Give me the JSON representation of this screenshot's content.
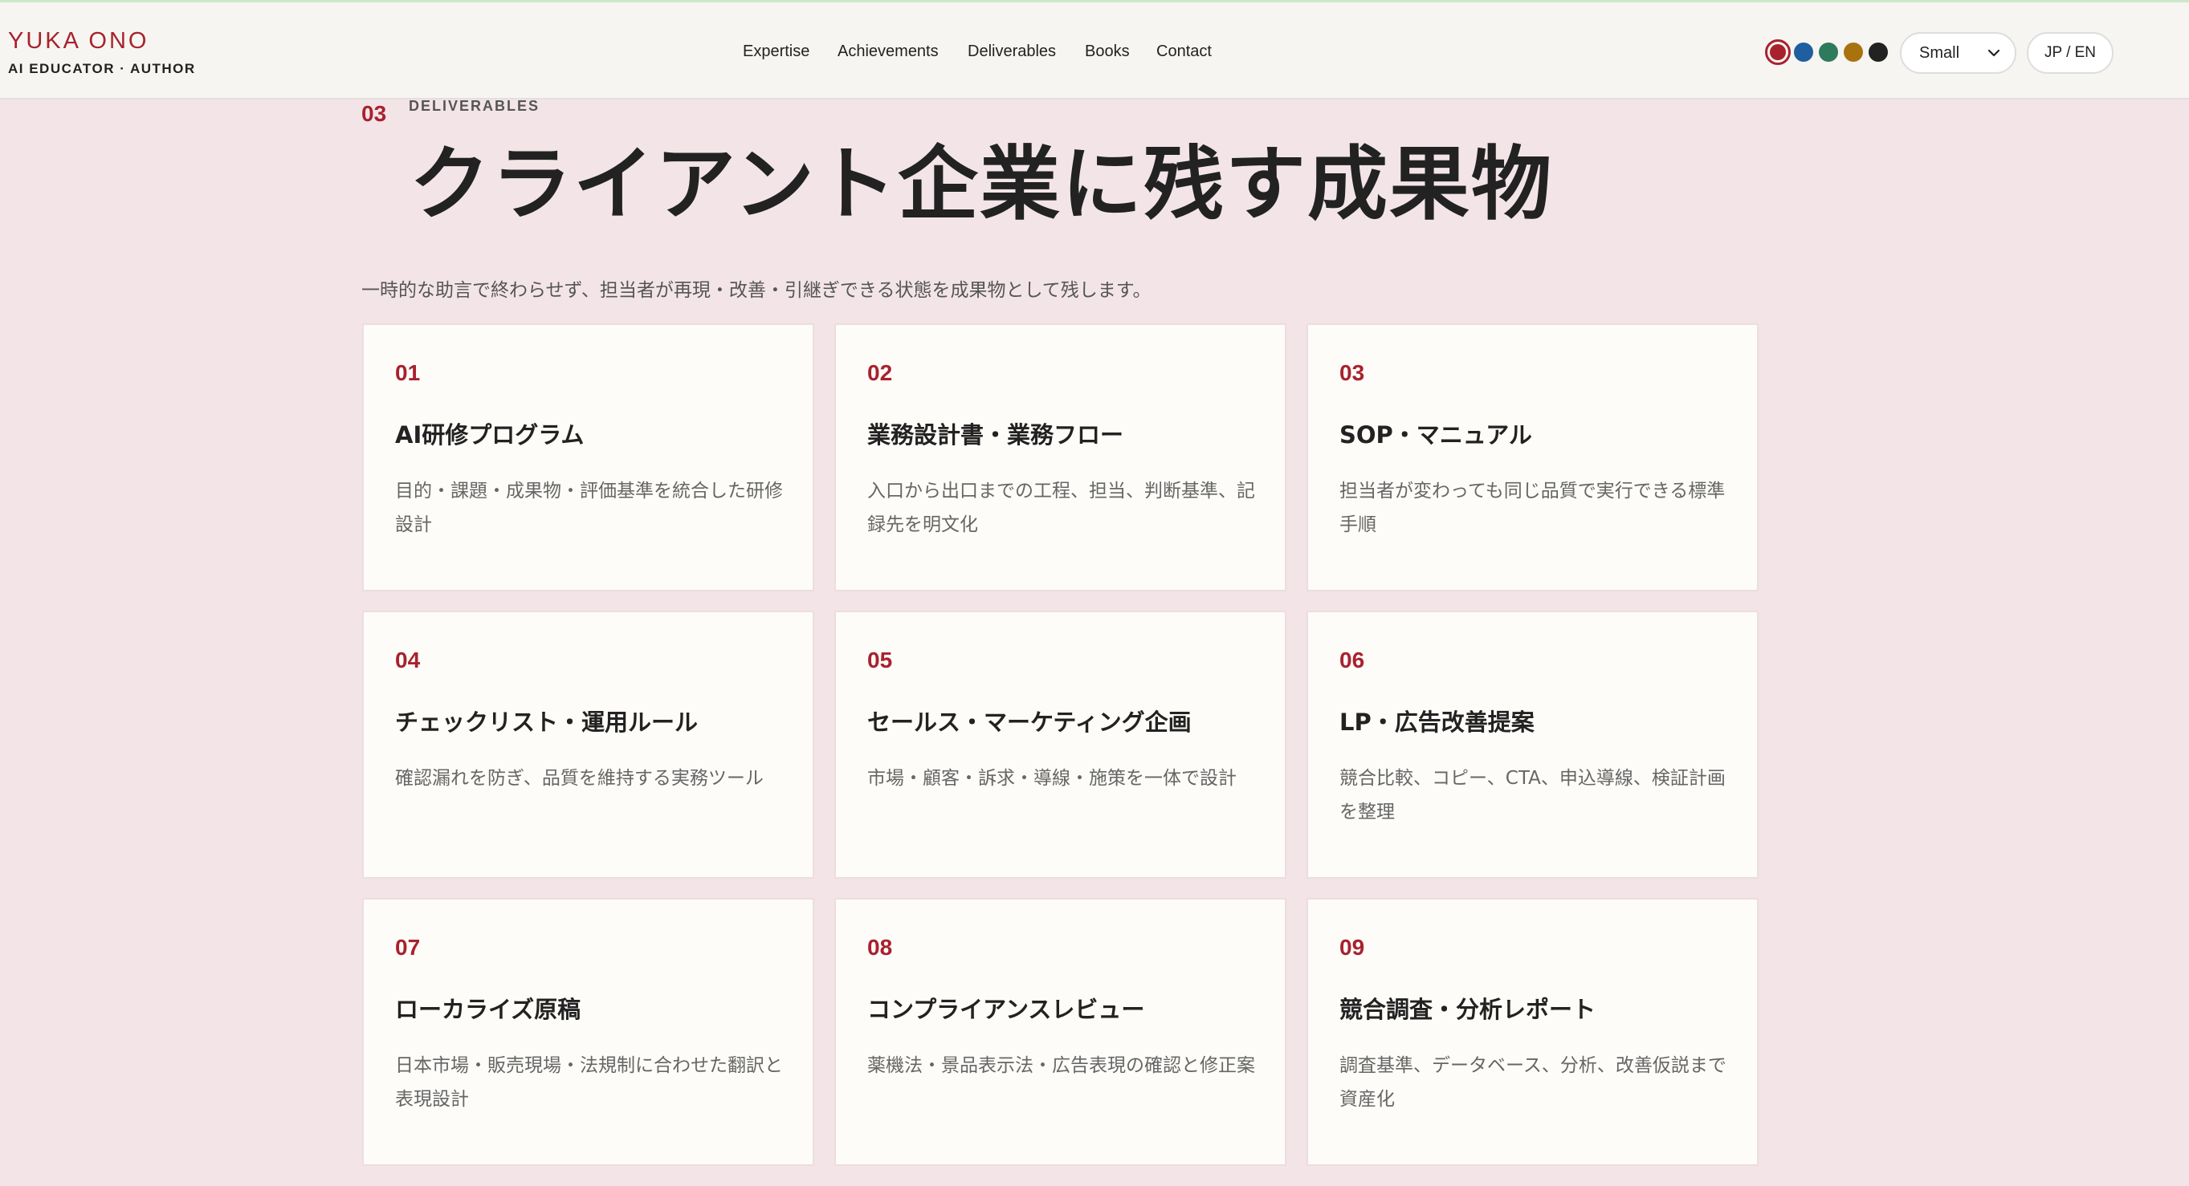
{
  "brand": {
    "name": "YUKA ONO",
    "tagline": "AI EDUCATOR · AUTHOR"
  },
  "nav": {
    "items": [
      "Expertise",
      "Achievements",
      "Deliverables",
      "Books",
      "Contact"
    ]
  },
  "theme": {
    "swatches": [
      "#a8222e",
      "#1f5fa0",
      "#2d7a5e",
      "#a8720f",
      "#222222"
    ],
    "selected_swatch": "#a8222e",
    "page_background": "#f3e5e7",
    "accent": "#a8222e"
  },
  "controls": {
    "size_value": "Small",
    "lang_label": "JP / EN"
  },
  "section": {
    "number": "03",
    "label": "DELIVERABLES",
    "title": "クライアント企業に残す成果物",
    "lead": "一時的な助言で終わらせず、担当者が再現・改善・引継ぎできる状態を成果物として残します。"
  },
  "cards": [
    {
      "num": "01",
      "title": "AI研修プログラム",
      "desc": "目的・課題・成果物・評価基準を統合した研修設計"
    },
    {
      "num": "02",
      "title": "業務設計書・業務フロー",
      "desc": "入口から出口までの工程、担当、判断基準、記録先を明文化"
    },
    {
      "num": "03",
      "title": "SOP・マニュアル",
      "desc": "担当者が変わっても同じ品質で実行できる標準手順"
    },
    {
      "num": "04",
      "title": "チェックリスト・運用ルール",
      "desc": "確認漏れを防ぎ、品質を維持する実務ツール"
    },
    {
      "num": "05",
      "title": "セールス・マーケティング企画",
      "desc": "市場・顧客・訴求・導線・施策を一体で設計"
    },
    {
      "num": "06",
      "title": "LP・広告改善提案",
      "desc": "競合比較、コピー、CTA、申込導線、検証計画を整理"
    },
    {
      "num": "07",
      "title": "ローカライズ原稿",
      "desc": "日本市場・販売現場・法規制に合わせた翻訳と表現設計"
    },
    {
      "num": "08",
      "title": "コンプライアンスレビュー",
      "desc": "薬機法・景品表示法・広告表現の確認と修正案"
    },
    {
      "num": "09",
      "title": "競合調査・分析レポート",
      "desc": "調査基準、データベース、分析、改善仮説まで資産化"
    }
  ]
}
